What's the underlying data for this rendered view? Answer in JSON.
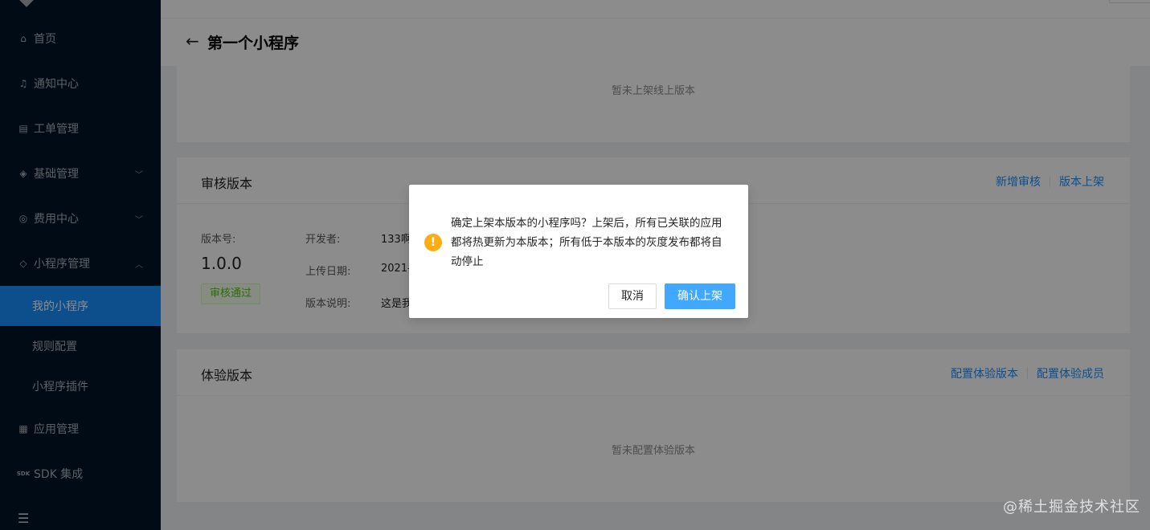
{
  "sidebar": {
    "items": [
      {
        "label": "首页",
        "icon": "home-icon"
      },
      {
        "label": "通知中心",
        "icon": "bell-icon"
      },
      {
        "label": "工单管理",
        "icon": "clipboard-icon"
      },
      {
        "label": "基础管理",
        "icon": "layers-icon"
      },
      {
        "label": "费用中心",
        "icon": "dollar-circle-icon"
      },
      {
        "label": "小程序管理",
        "icon": "miniprogram-icon"
      }
    ],
    "sub_items": [
      {
        "label": "我的小程序"
      },
      {
        "label": "规则配置"
      },
      {
        "label": "小程序插件"
      }
    ],
    "bottom_items": [
      {
        "label": "应用管理",
        "icon": "appstore-icon"
      },
      {
        "label": "SDK 集成",
        "icon_text": "SDK"
      }
    ]
  },
  "page": {
    "back_icon": "arrow-left-icon",
    "title": "第一个小程序"
  },
  "online_card": {
    "empty_text": "暂未上架线上版本"
  },
  "review_card": {
    "title": "审核版本",
    "actions": [
      "新增审核",
      "版本上架"
    ],
    "version_label": "版本号:",
    "version_value": "1.0.0",
    "status": "审核通过",
    "developer_label": "开发者:",
    "developer_value": "133啊",
    "upload_label": "上传日期:",
    "upload_value": "2021-",
    "desc_label": "版本说明:",
    "desc_value": "这是我"
  },
  "trial_card": {
    "title": "体验版本",
    "actions": [
      "配置体验版本",
      "配置体验成员"
    ],
    "empty_text": "暂未配置体验版本"
  },
  "modal": {
    "icon": "exclamation-circle-icon",
    "message": "确定上架本版本的小程序吗？上架后，所有已关联的应用都将热更新为本版本；所有低于本版本的灰度发布都将自动停止",
    "cancel_label": "取消",
    "ok_label": "确认上架"
  },
  "watermark": "@稀土掘金技术社区",
  "colors": {
    "sidebar_bg": "#001529",
    "primary": "#1890ff",
    "warning": "#faad14",
    "success": "#52c41a"
  }
}
